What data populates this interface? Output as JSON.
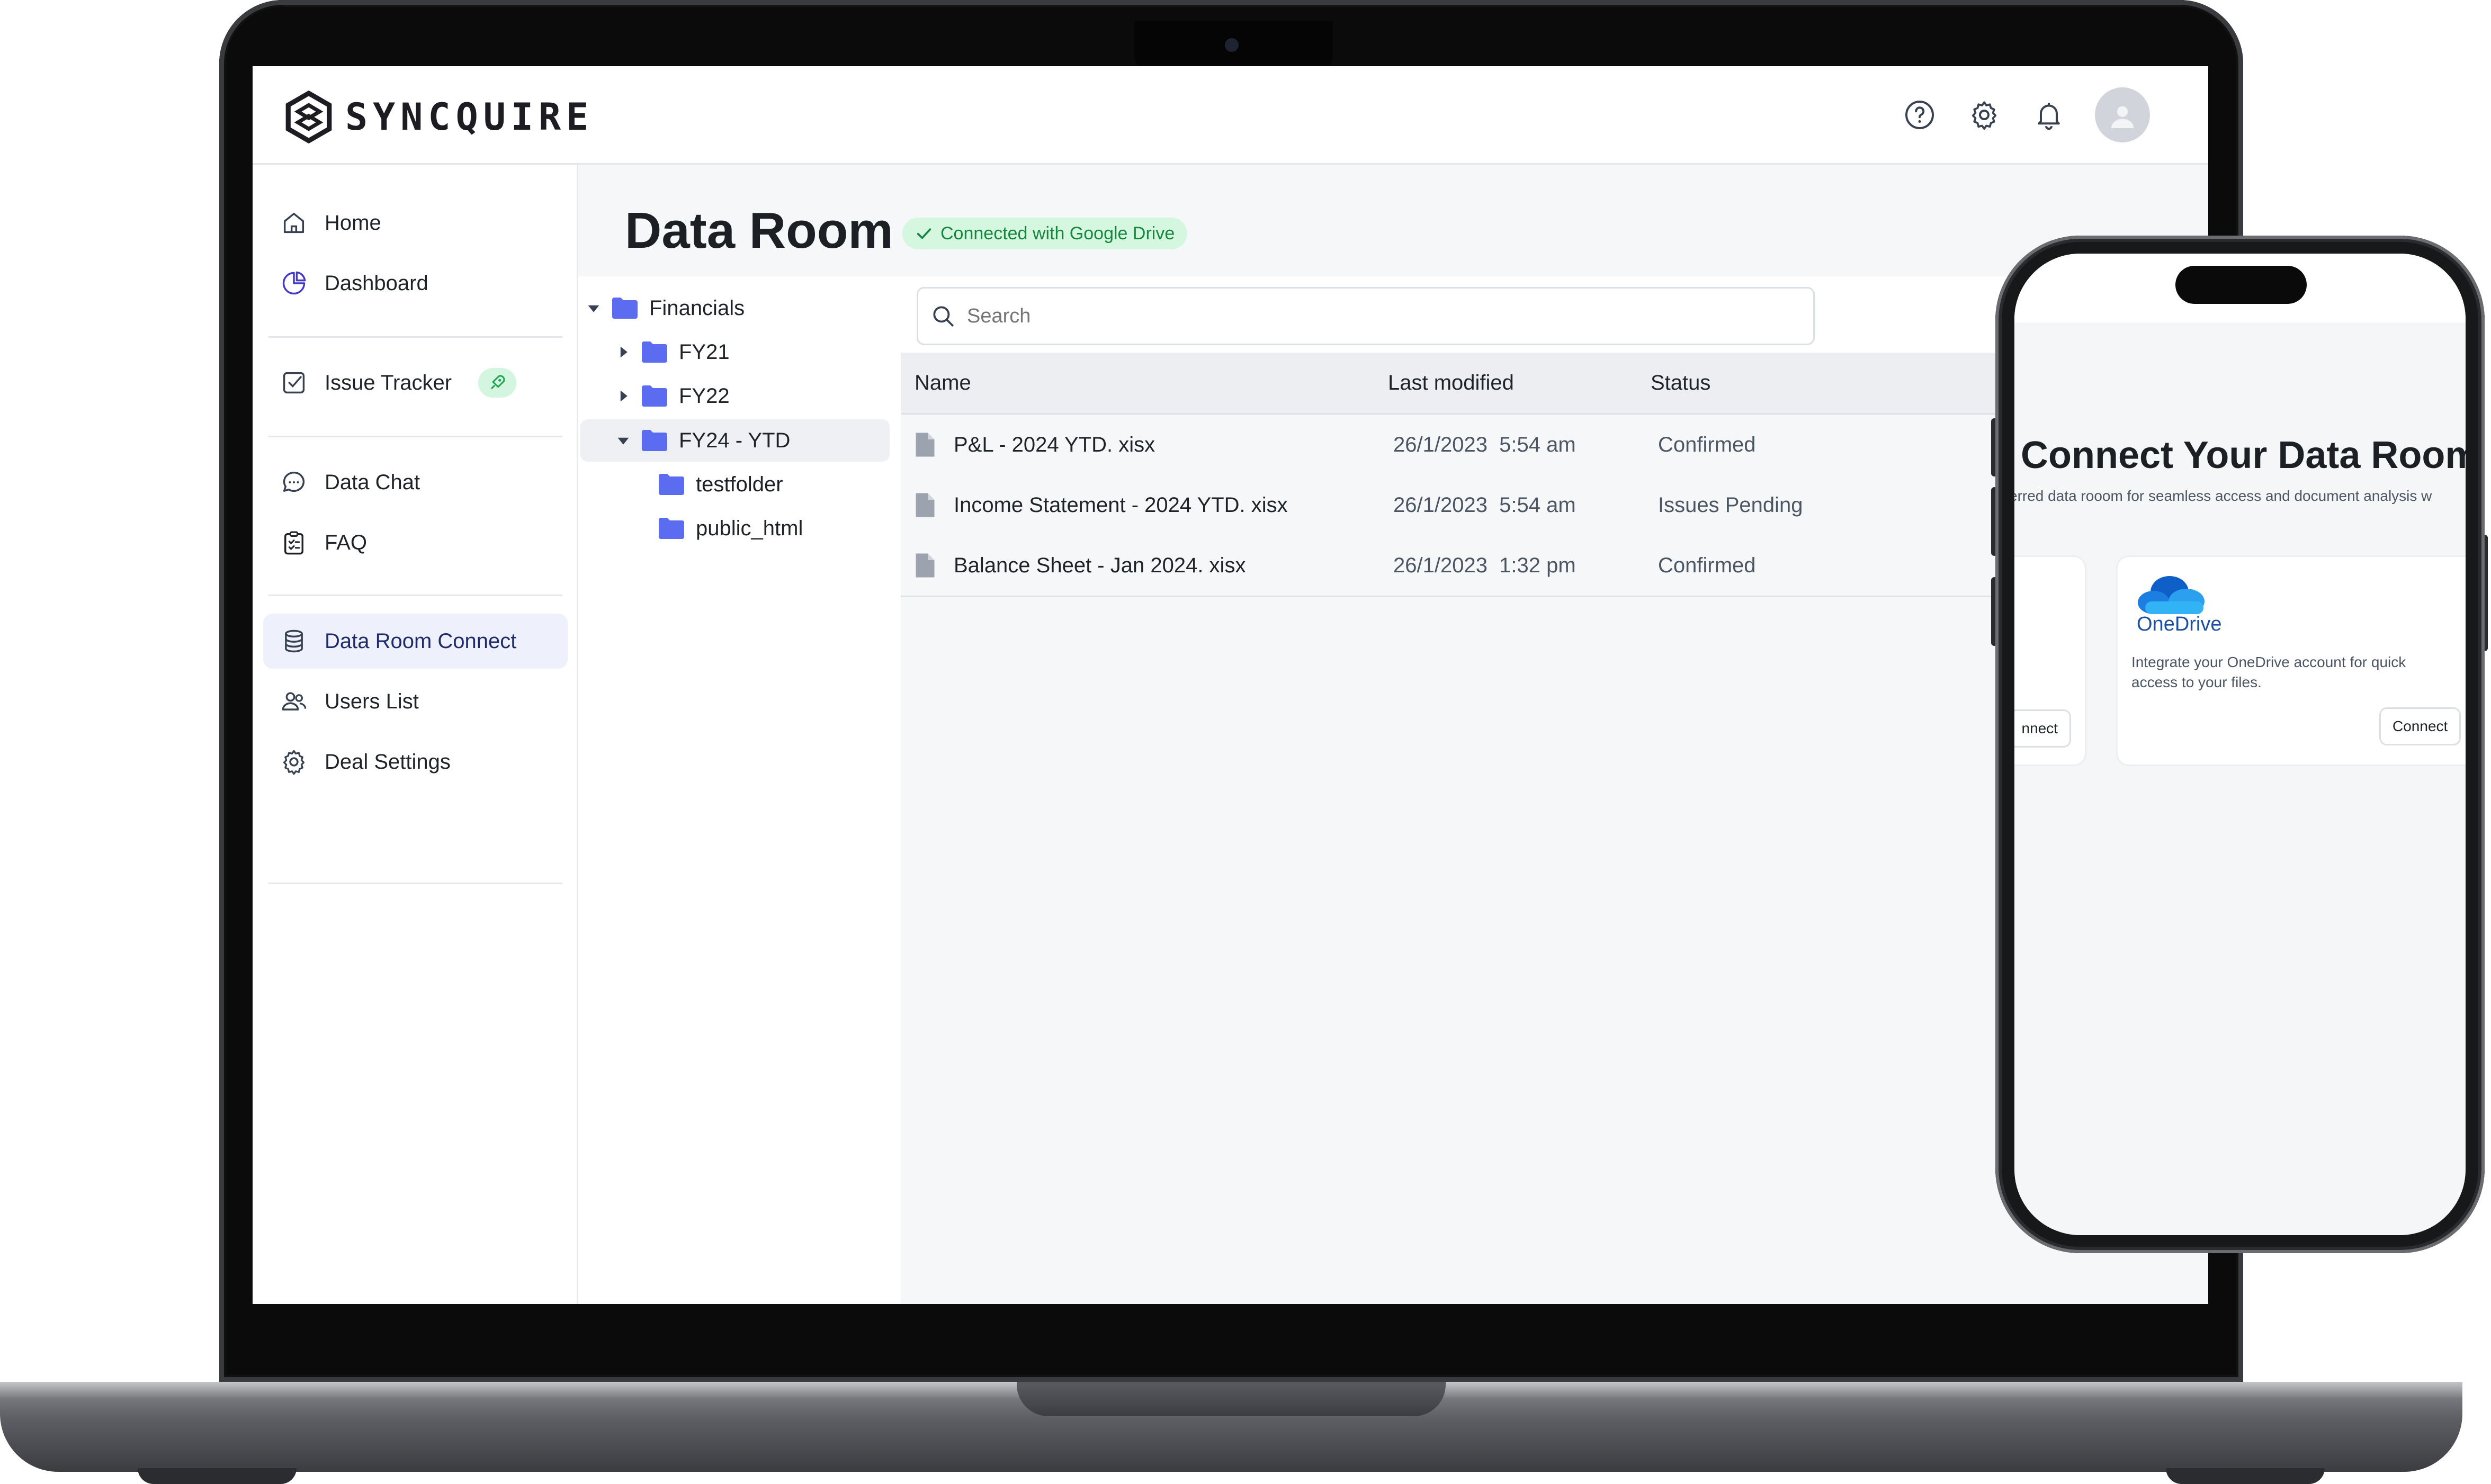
{
  "app": {
    "logo_text": "SYNCQUIRE"
  },
  "sidebar": {
    "items": [
      {
        "label": "Home",
        "icon": "home-icon"
      },
      {
        "label": "Dashboard",
        "icon": "pie-chart-icon"
      },
      {
        "label": "Issue Tracker",
        "icon": "checkbox-icon"
      },
      {
        "label": "Data Chat",
        "icon": "chat-bubble-icon"
      },
      {
        "label": "FAQ",
        "icon": "clipboard-icon"
      },
      {
        "label": "Data Room Connect",
        "icon": "database-icon"
      },
      {
        "label": "Users List",
        "icon": "users-icon"
      },
      {
        "label": "Deal Settings",
        "icon": "gear-icon"
      }
    ]
  },
  "main": {
    "title": "Data Room",
    "badge": "Connected with Google Drive",
    "tree": [
      {
        "label": "Financials",
        "expanded": true
      },
      {
        "label": "FY21",
        "expanded": false
      },
      {
        "label": "FY22",
        "expanded": false
      },
      {
        "label": "FY24 - YTD",
        "expanded": true,
        "selected": true
      },
      {
        "label": "testfolder"
      },
      {
        "label": "public_html"
      }
    ],
    "search": {
      "placeholder": "Search"
    },
    "table": {
      "columns": [
        "Name",
        "Last modified",
        "Status"
      ],
      "rows": [
        {
          "name": "P&L - 2024 YTD. xisx",
          "modified": "26/1/2023  5:54 am",
          "status": "Confirmed"
        },
        {
          "name": "Income Statement - 2024 YTD. xisx",
          "modified": "26/1/2023  5:54 am",
          "status": "Issues Pending"
        },
        {
          "name": "Balance Sheet - Jan 2024. xisx",
          "modified": "26/1/2023  1:32 pm",
          "status": "Confirmed"
        }
      ]
    }
  },
  "phone": {
    "title": "Connect Your Data Room",
    "subtitle": "erred data rooom for seamless access and document analysis w",
    "left_card": {
      "button": "nnect"
    },
    "onedrive_card": {
      "name": "OneDrive",
      "description_line1": "Integrate your OneDrive account for quick",
      "description_line2": "access to your files.",
      "button": "Connect"
    }
  },
  "colors": {
    "accent_folder": "#5b6cf0",
    "badge_green_bg": "#d6f7df",
    "badge_green_text": "#17863f",
    "active_nav_bg": "#eef0fb"
  }
}
